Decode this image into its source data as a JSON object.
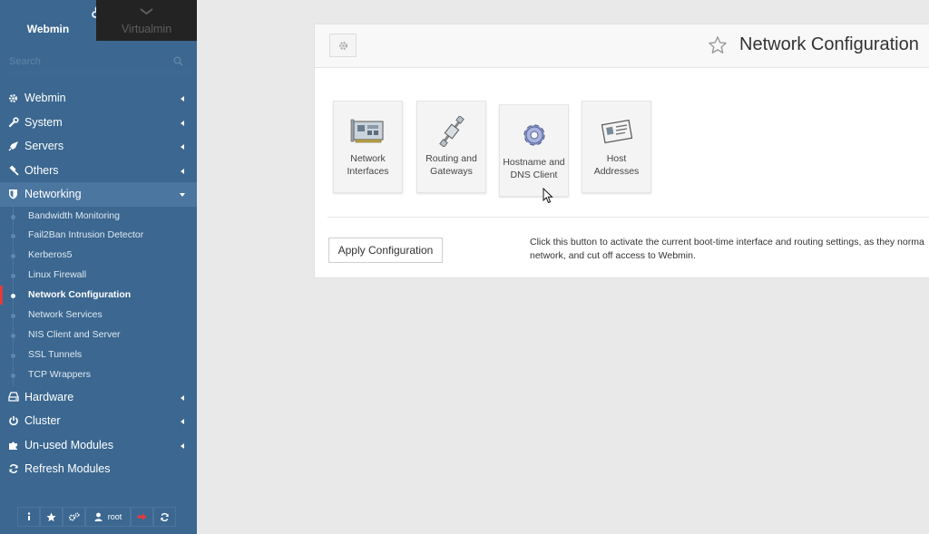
{
  "switcher": {
    "webmin_label": "Webmin",
    "virtualmin_label": "Virtualmin"
  },
  "search": {
    "placeholder": "Search"
  },
  "menu": {
    "webmin": "Webmin",
    "system": "System",
    "servers": "Servers",
    "others": "Others",
    "networking": "Networking",
    "networking_items": [
      "Bandwidth Monitoring",
      "Fail2Ban Intrusion Detector",
      "Kerberos5",
      "Linux Firewall",
      "Network Configuration",
      "Network Services",
      "NIS Client and Server",
      "SSL Tunnels",
      "TCP Wrappers"
    ],
    "hardware": "Hardware",
    "cluster": "Cluster",
    "unused": "Un-used Modules",
    "refresh": "Refresh Modules"
  },
  "bottombar": {
    "user": "root"
  },
  "page": {
    "title": "Network Configuration"
  },
  "tiles": [
    {
      "line1": "Network",
      "line2": "Interfaces"
    },
    {
      "line1": "Routing and",
      "line2": "Gateways"
    },
    {
      "line1": "Hostname and",
      "line2": "DNS Client"
    },
    {
      "line1": "Host",
      "line2": "Addresses"
    }
  ],
  "apply": {
    "button": "Apply Configuration",
    "desc_line1": "Click this button to activate the current boot-time interface and routing settings, as they norma",
    "desc_line2": "network, and cut off access to Webmin."
  },
  "colors": {
    "sidebar": "#3b6790",
    "active_marker": "#e23c3c",
    "background": "#e9e9e9"
  }
}
